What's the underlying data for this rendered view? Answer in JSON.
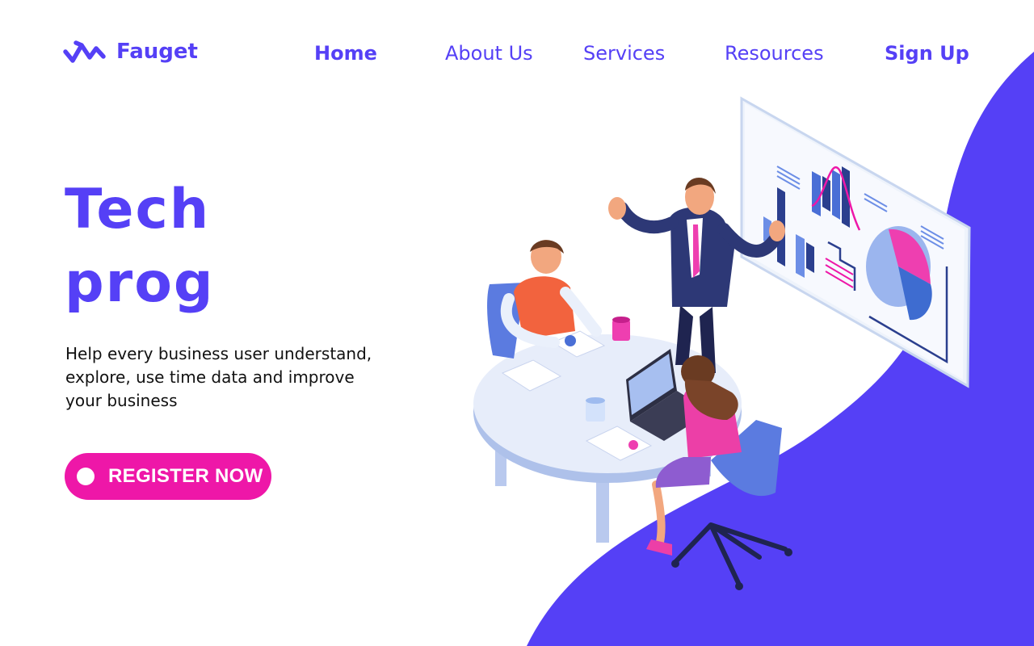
{
  "brand": {
    "name": "Fauget",
    "icon": "zigzag-logo-icon"
  },
  "nav": {
    "home": "Home",
    "about": "About Us",
    "services": "Services",
    "resources": "Resources",
    "signup": "Sign Up"
  },
  "hero": {
    "title_line1": "Tech",
    "title_line2": "prog",
    "subtitle": "Help every business user understand, explore, use time data and improve your business",
    "cta_label": "REGISTER NOW"
  },
  "illustration": {
    "icon": "business-meeting-illustration"
  },
  "colors": {
    "primary": "#5540f6",
    "accent": "#ee17a8",
    "background": "#ffffff",
    "text": "#111111"
  }
}
